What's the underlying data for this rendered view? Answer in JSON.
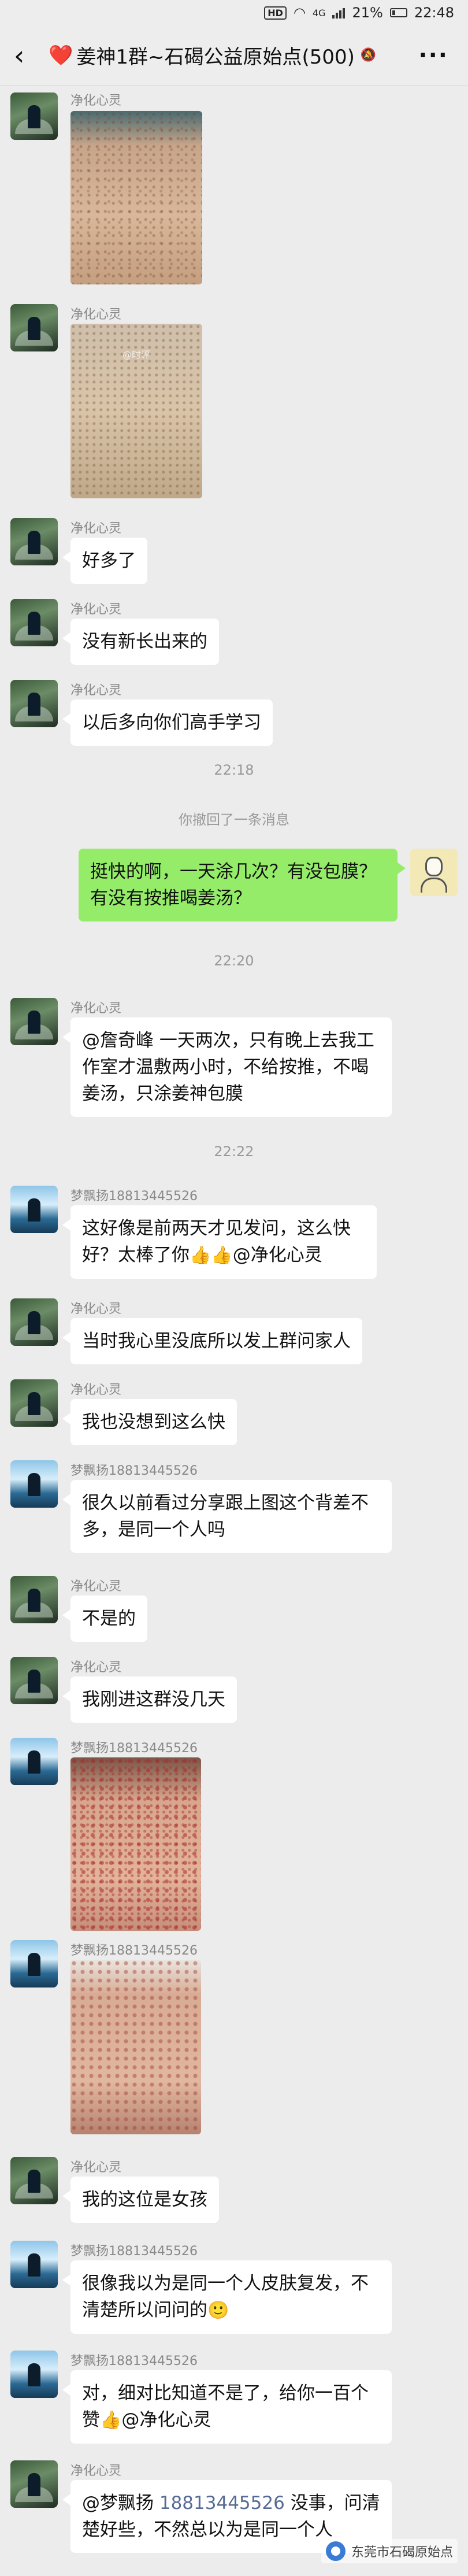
{
  "statusbar": {
    "hd": "HD",
    "network": "4G",
    "battery": "21%",
    "time": "22:48"
  },
  "navbar": {
    "back_icon": "chevron-left-icon",
    "heart": "❤️",
    "title": "姜神1群~石碣公益原始点(500)",
    "more_icon": "more-icon"
  },
  "messages": [
    {
      "nick": "净化心灵"
    },
    {
      "nick": "净化心灵",
      "watermark": "@时评"
    },
    {
      "nick": "净化心灵",
      "text": "好多了"
    },
    {
      "nick": "净化心灵",
      "text": "没有新长出来的"
    },
    {
      "nick": "净化心灵",
      "text": "以后多向你们高手学习"
    },
    {
      "time": "22:18"
    },
    {
      "sys": "你撤回了一条消息"
    },
    {
      "text": "挺快的啊，一天涂几次？有没包膜？有没有按推喝姜汤？"
    },
    {
      "time": "22:20"
    },
    {
      "nick": "净化心灵",
      "text": "@詹奇峰  一天两次，只有晚上去我工作室才温敷两小时，不给按推，不喝姜汤，只涂姜神包膜"
    },
    {
      "time": "22:22"
    },
    {
      "nick": "梦飘扬18813445526",
      "text": "这好像是前两天才见发问，这么快好？太棒了你",
      "text2": "@净化心灵"
    },
    {
      "nick": "净化心灵",
      "text": "当时我心里没底所以发上群问家人"
    },
    {
      "nick": "净化心灵",
      "text": "我也没想到这么快"
    },
    {
      "nick": "梦飘扬18813445526",
      "text": "很久以前看过分享跟上图这个背差不多，是同一个人吗"
    },
    {
      "nick": "净化心灵",
      "text": "不是的"
    },
    {
      "nick": "净化心灵",
      "text": "我刚进这群没几天"
    },
    {
      "nick": "梦飘扬18813445526"
    },
    {
      "nick": "梦飘扬18813445526"
    },
    {
      "nick": "净化心灵",
      "text": "我的这位是女孩"
    },
    {
      "nick": "梦飘扬18813445526",
      "text": "很像我以为是同一个人皮肤复发，不清楚所以问问的"
    },
    {
      "nick": "梦飘扬18813445526",
      "text": "对，细对比知道不是了，给你一百个赞",
      "text2": "@净化心灵"
    },
    {
      "nick": "净化心灵",
      "mention": "@梦飘扬",
      "phone": "18813445526",
      "text": "没事，问清楚好些，不然总以为是同一个人"
    }
  ],
  "watermark": {
    "text": "东莞市石碣原始点"
  }
}
